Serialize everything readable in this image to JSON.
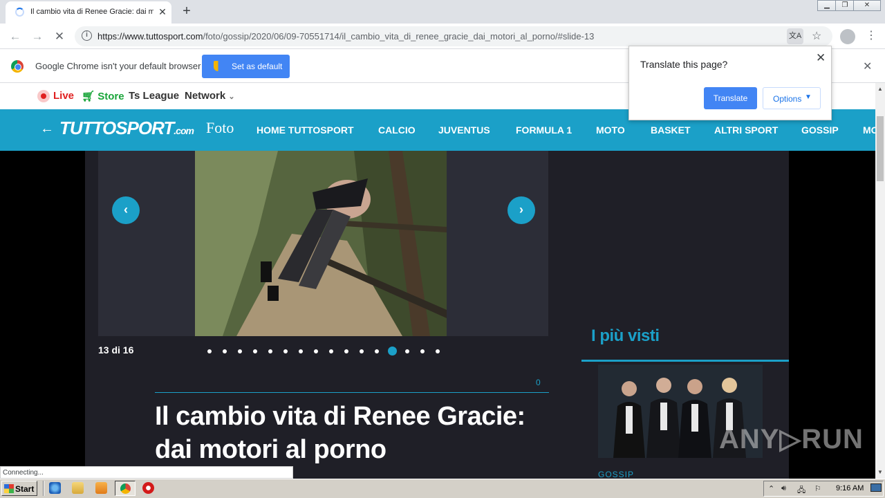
{
  "browser": {
    "tab_title": "Il cambio vita di Renee Gracie: dai m",
    "tab_close": "✕",
    "new_tab": "+",
    "window_buttons": [
      "▁",
      "❐",
      "✕"
    ],
    "url_host": "https://www.tuttosport.com",
    "url_path": "/foto/gossip/2020/06/09-70551714/il_cambio_vita_di_renee_gracie_dai_motori_al_porno/#slide-13",
    "status_text": "Connecting..."
  },
  "infobar": {
    "message": "Google Chrome isn't your default browser",
    "button_label": "Set as default",
    "close": "✕"
  },
  "translate_popup": {
    "question": "Translate this page?",
    "translate_label": "Translate",
    "options_label": "Options",
    "close": "✕"
  },
  "site": {
    "top_links": {
      "live": "Live",
      "store": "Store",
      "league": "Ts League",
      "network": "Network"
    },
    "logo": "TUTTOSPORT",
    "logo_suffix": ".com",
    "section": "Foto",
    "nav_items": [
      "HOME TUTTOSPORT",
      "CALCIO",
      "JUVENTUS",
      "FORMULA 1",
      "MOTO",
      "BASKET",
      "ALTRI SPORT",
      "GOSSIP",
      "MO"
    ]
  },
  "gallery": {
    "counter": "13 di 16",
    "current_slide": 13,
    "total_slides": 16,
    "comment_count": "0",
    "headline": "Il cambio vita di Renee Gracie: dai motori al porno"
  },
  "sidebar": {
    "heading": "I più visti",
    "thumb_category": "GOSSIP"
  },
  "watermark": "ANY▷RUN",
  "taskbar": {
    "start_label": "Start",
    "clock": "9:16 AM"
  },
  "colors": {
    "brand": "#1ba0c8",
    "content_bg": "#1f1f27",
    "chrome_blue": "#4285f4"
  }
}
